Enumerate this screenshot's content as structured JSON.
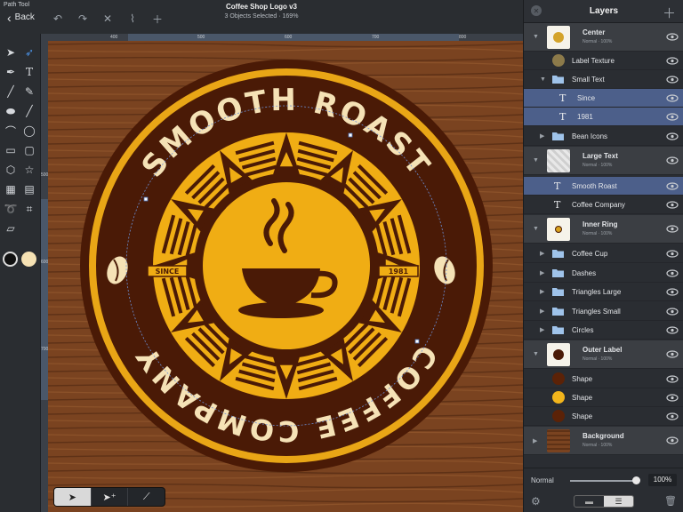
{
  "topbar": {
    "tool_name": "Path Tool",
    "back_label": "Back",
    "doc_title": "Coffee Shop Logo v3",
    "doc_status": "3 Objects Selected · 169%"
  },
  "ruler": {
    "top_ticks": [
      "400",
      "500",
      "600",
      "700",
      "800"
    ],
    "left_ticks": [
      "500",
      "600",
      "700"
    ]
  },
  "logo": {
    "top_text": "SMOOTH ROAST",
    "bottom_text": "COFFEE COMPANY",
    "since_label": "SINCE",
    "year_label": "1981"
  },
  "colors": {
    "dark_brown": "#4a1a06",
    "gold": "#f0ad14",
    "cream": "#f5e2b6",
    "wood": "#7a4320",
    "selection_blue": "#4c5f8a"
  },
  "layers_panel": {
    "title": "Layers",
    "items": [
      {
        "name": "Center",
        "sub": "Normal · 100%"
      },
      {
        "name": "Label Texture"
      },
      {
        "name": "Small Text"
      },
      {
        "name": "Since"
      },
      {
        "name": "1981"
      },
      {
        "name": "Bean Icons"
      },
      {
        "name": "Large Text",
        "sub": "Normal · 100%"
      },
      {
        "name": "Smooth Roast"
      },
      {
        "name": "Coffee Company"
      },
      {
        "name": "Inner Ring",
        "sub": "Normal · 100%"
      },
      {
        "name": "Coffee Cup"
      },
      {
        "name": "Dashes"
      },
      {
        "name": "Triangles Large"
      },
      {
        "name": "Triangles Small"
      },
      {
        "name": "Circles"
      },
      {
        "name": "Outer Label",
        "sub": "Normal · 100%"
      },
      {
        "name": "Shape"
      },
      {
        "name": "Shape"
      },
      {
        "name": "Shape"
      },
      {
        "name": "Background",
        "sub": "Normal · 100%"
      }
    ],
    "blend_mode": "Normal",
    "opacity": "100%"
  },
  "icons": {
    "close": "close-icon",
    "add": "plus-icon",
    "eye": "eye-icon",
    "settings": "gear-icon",
    "delete": "trash-icon"
  }
}
